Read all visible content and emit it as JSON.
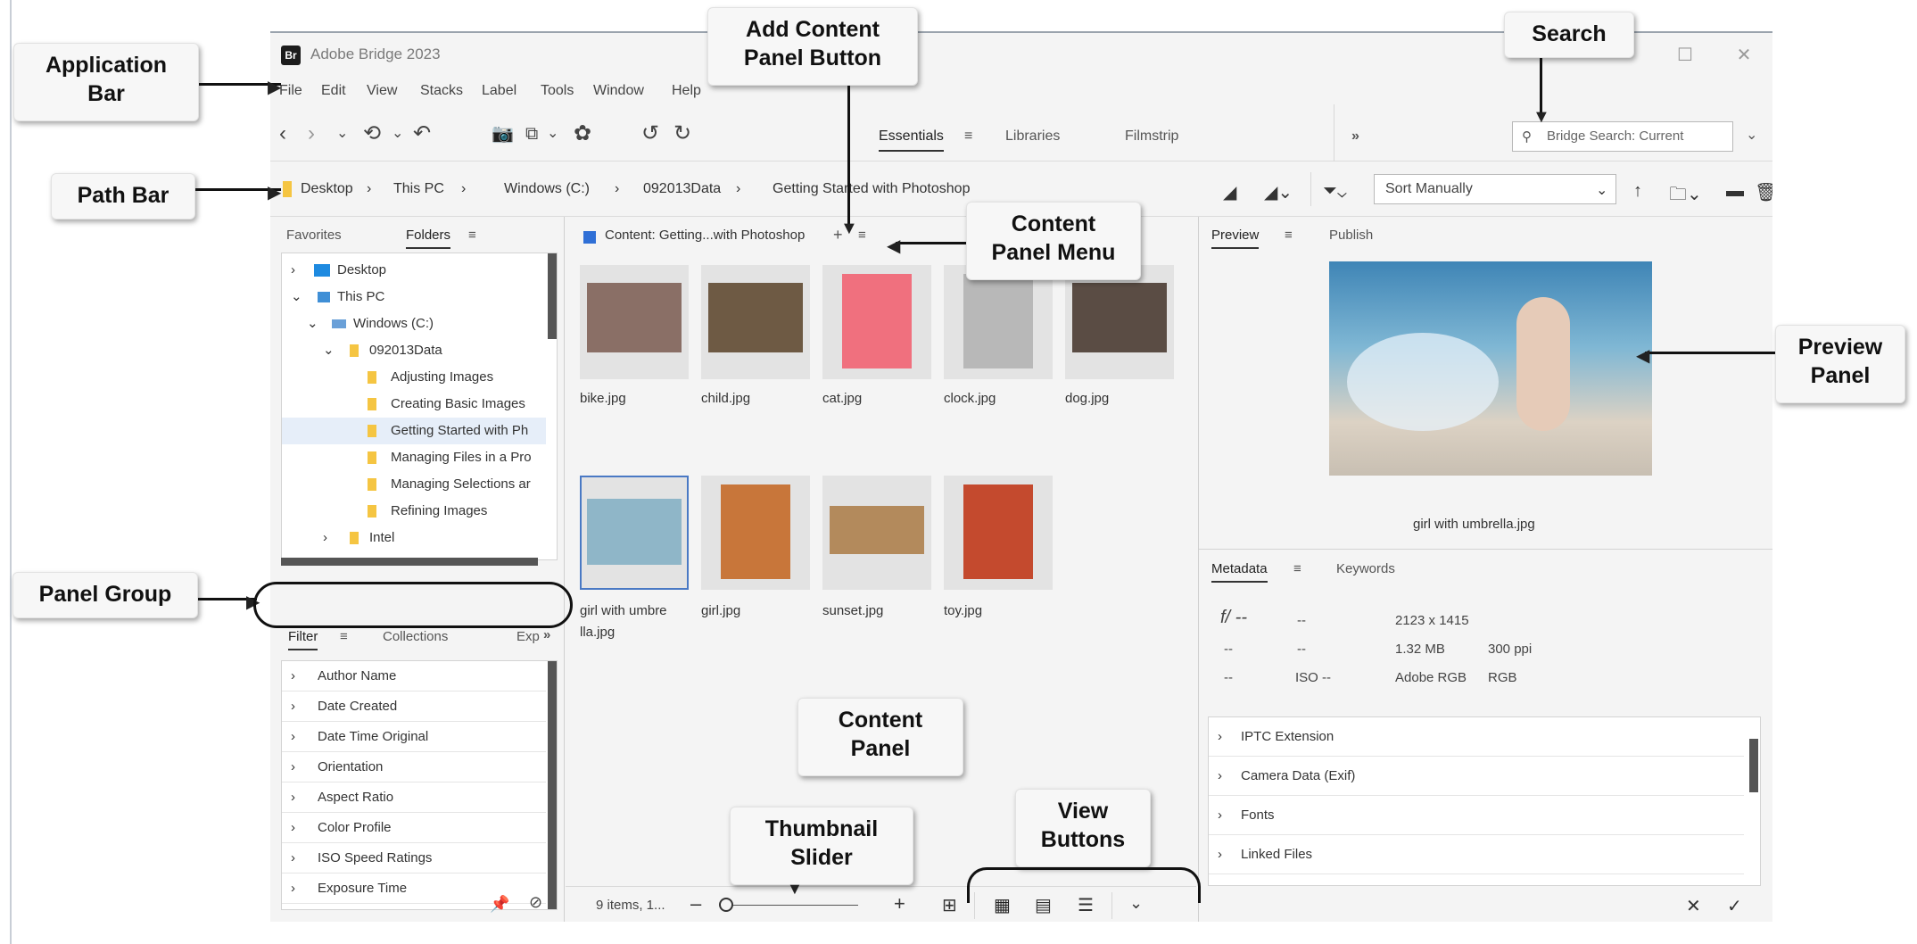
{
  "app": {
    "icon_text": "Br",
    "title": "Adobe Bridge 2023",
    "menu": [
      "File",
      "Edit",
      "View",
      "Stacks",
      "Label",
      "Tools",
      "Window",
      "Help"
    ]
  },
  "workspaces": [
    "Essentials",
    "Libraries",
    "Filmstrip"
  ],
  "overflow_label": "»",
  "search": {
    "placeholder": "Bridge Search: Current"
  },
  "path": [
    "Desktop",
    "This PC",
    "Windows (C:)",
    "092013Data",
    "Getting Started with Photoshop"
  ],
  "sort": {
    "label": "Sort Manually"
  },
  "left_panel": {
    "tabs": [
      "Favorites",
      "Folders"
    ],
    "tree": [
      {
        "label": "Desktop",
        "chevron": ">"
      },
      {
        "label": "This PC",
        "chevron": "v"
      },
      {
        "label": "Windows (C:)",
        "chevron": "v"
      },
      {
        "label": "092013Data",
        "chevron": "v"
      },
      {
        "label": "Adjusting Images",
        "chevron": ""
      },
      {
        "label": "Creating Basic Images",
        "chevron": ""
      },
      {
        "label": "Getting Started with Ph",
        "chevron": ""
      },
      {
        "label": "Managing Files in a Pro",
        "chevron": ""
      },
      {
        "label": "Managing Selections ar",
        "chevron": ""
      },
      {
        "label": "Refining Images",
        "chevron": ""
      },
      {
        "label": "Intel",
        "chevron": ">"
      }
    ],
    "filter_tabs": [
      "Filter",
      "Collections",
      "Exp"
    ],
    "filters": [
      "Author Name",
      "Date Created",
      "Date Time Original",
      "Orientation",
      "Aspect Ratio",
      "Color Profile",
      "ISO Speed Ratings",
      "Exposure Time"
    ]
  },
  "content_panel": {
    "title": "Content: Getting...with Photoshop",
    "items": [
      {
        "name": "bike.jpg",
        "icon": "bike-thumbnail",
        "color": "#8a6f66"
      },
      {
        "name": "child.jpg",
        "icon": "child-thumbnail",
        "color": "#6e5a44"
      },
      {
        "name": "cat.jpg",
        "icon": "cat-thumbnail",
        "color": "#f0707e"
      },
      {
        "name": "clock.jpg",
        "icon": "clock-thumbnail",
        "color": "#b8b8b8"
      },
      {
        "name": "dog.jpg",
        "icon": "dog-thumbnail",
        "color": "#5a4c44"
      },
      {
        "name": "girl with umbre\nlla.jpg",
        "icon": "girl-umbrella-thumbnail",
        "color": "#8fb6c8"
      },
      {
        "name": "girl.jpg",
        "icon": "girl-thumbnail",
        "color": "#c8763a"
      },
      {
        "name": "sunset.jpg",
        "icon": "sunset-thumbnail",
        "color": "#b38a5c"
      },
      {
        "name": "toy.jpg",
        "icon": "toy-thumbnail",
        "color": "#c44a2e"
      }
    ],
    "status": "9 items, 1..."
  },
  "preview_panel": {
    "tabs": [
      "Preview",
      "Publish"
    ],
    "caption": "girl with umbrella.jpg"
  },
  "metadata_panel": {
    "tabs": [
      "Metadata",
      "Keywords"
    ],
    "rows": [
      [
        "f/ --",
        "--",
        "2123 x 1415",
        ""
      ],
      [
        "--",
        "--",
        "1.32 MB",
        "300 ppi"
      ],
      [
        "--",
        "ISO --",
        "Adobe RGB",
        "RGB"
      ]
    ],
    "sections": [
      "IPTC Extension",
      "Camera Data (Exif)",
      "Fonts",
      "Linked Files"
    ]
  },
  "callouts": {
    "application_bar": "Application\nBar",
    "path_bar": "Path Bar",
    "panel_group": "Panel Group",
    "add_content": "Add Content\nPanel Button",
    "search": "Search",
    "content_menu": "Content\nPanel Menu",
    "preview_panel": "Preview\nPanel",
    "content_panel": "Content\nPanel",
    "thumbnail_slider": "Thumbnail\nSlider",
    "view_buttons": "View\nButtons"
  },
  "colors": {
    "accent": "#4a79c4",
    "folder": "#f5c542",
    "dark_scroll": "#555555"
  }
}
